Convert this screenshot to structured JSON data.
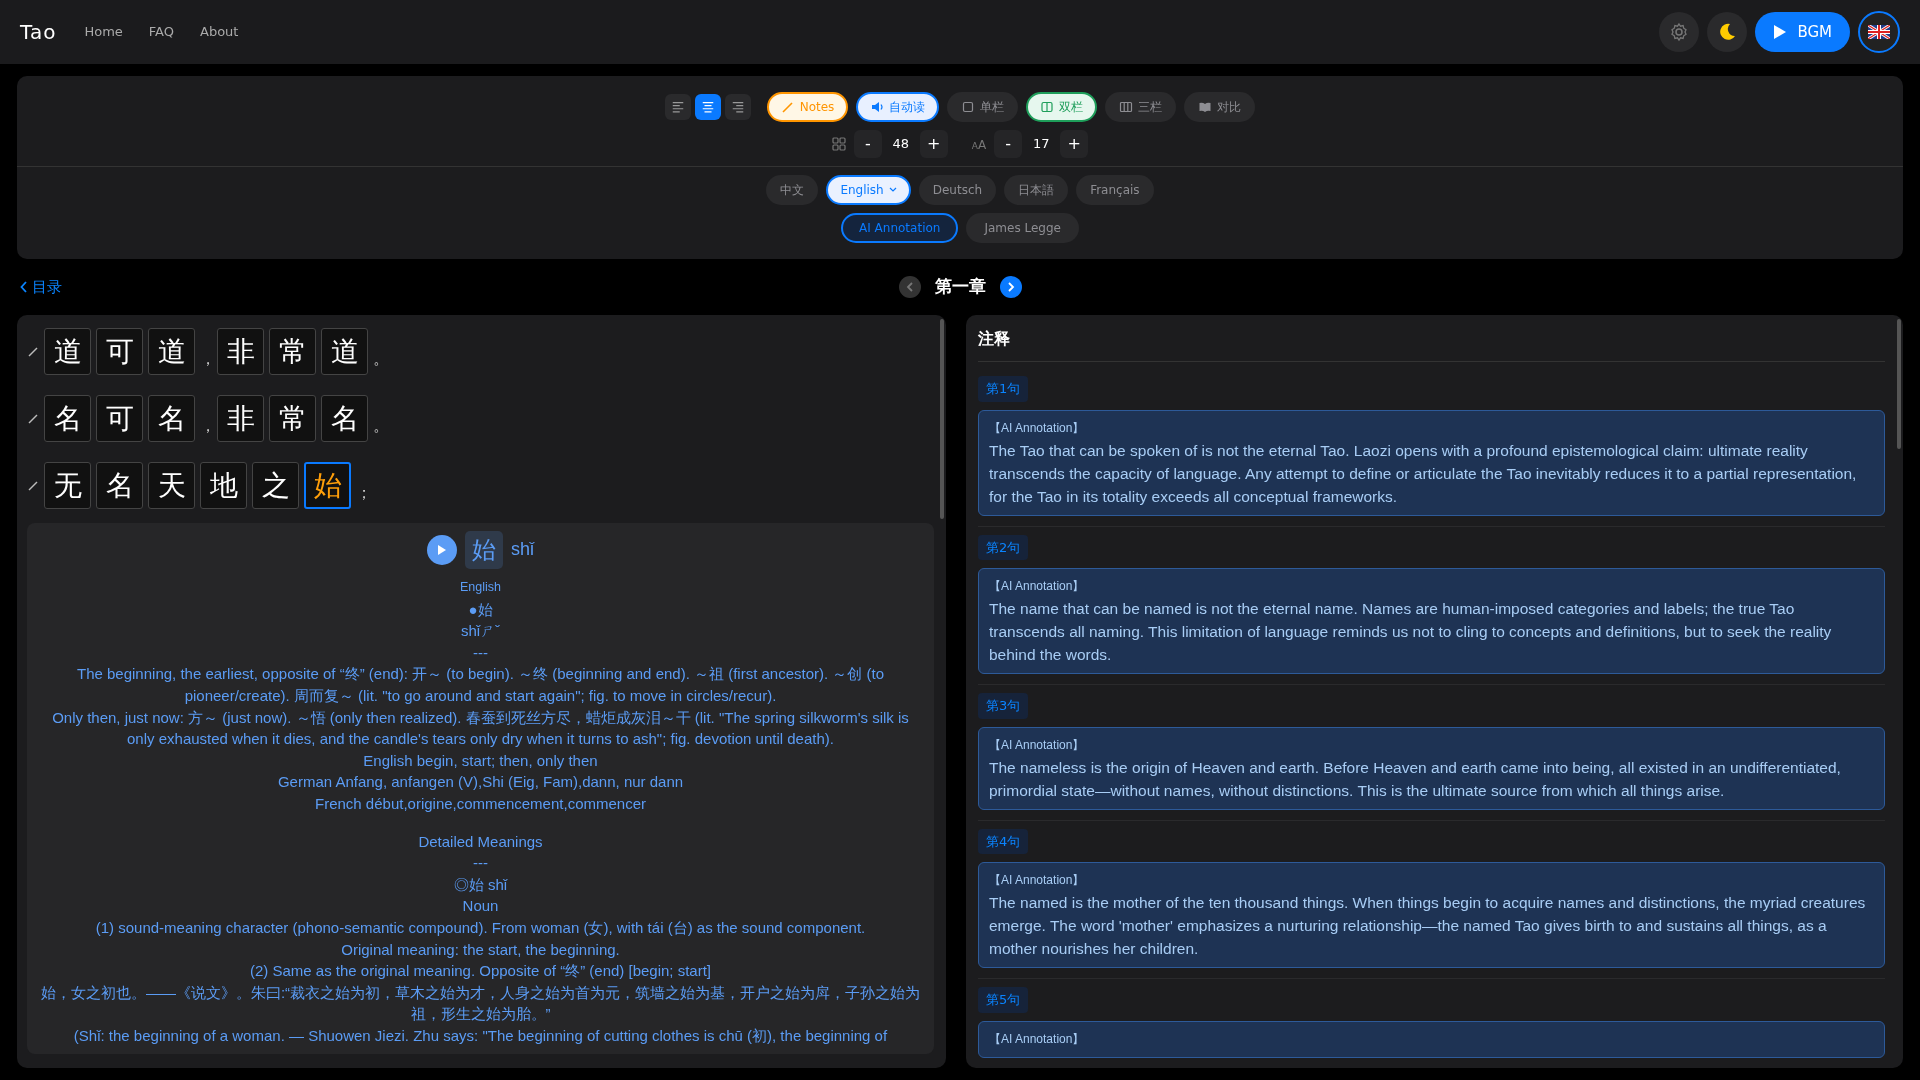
{
  "navbar": {
    "brand": "Tao",
    "links": [
      "Home",
      "FAQ",
      "About"
    ],
    "bgm_button": "BGM"
  },
  "toolbar": {
    "align": [
      {
        "kind": "left",
        "selected": false
      },
      {
        "kind": "center",
        "selected": true
      },
      {
        "kind": "right",
        "selected": false
      }
    ],
    "toggles": [
      {
        "kind": "notes",
        "label": "Notes",
        "on": true
      },
      {
        "kind": "audio",
        "label": "自动读",
        "on": true
      },
      {
        "kind": "single",
        "label": "单栏",
        "on": false
      },
      {
        "kind": "double",
        "label": "双栏",
        "on": true
      },
      {
        "kind": "triple",
        "label": "三栏",
        "on": false
      },
      {
        "kind": "compare",
        "label": "对比",
        "on": false
      }
    ],
    "grid_size": "48",
    "font_label": "AA",
    "font_size": "17",
    "decrease": "-",
    "increase": "+",
    "languages": [
      {
        "label": "中文",
        "selected": false
      },
      {
        "label": "English",
        "selected": true
      },
      {
        "label": "Deutsch",
        "selected": false
      },
      {
        "label": "日本語",
        "selected": false
      },
      {
        "label": "Français",
        "selected": false
      }
    ],
    "sources": [
      {
        "label": "AI Annotation",
        "selected": true
      },
      {
        "label": "James Legge",
        "selected": false
      }
    ]
  },
  "chapter_nav": {
    "back": "目录",
    "title": "第一章",
    "prev_enabled": false,
    "next_enabled": true
  },
  "verses": [
    {
      "tokens": [
        {
          "kind": "char",
          "text": "道",
          "selected": false
        },
        {
          "kind": "char",
          "text": "可",
          "selected": false
        },
        {
          "kind": "char",
          "text": "道",
          "selected": false
        },
        {
          "kind": "punct",
          "text": "，"
        },
        {
          "kind": "char",
          "text": "非",
          "selected": false
        },
        {
          "kind": "char",
          "text": "常",
          "selected": false
        },
        {
          "kind": "char",
          "text": "道",
          "selected": false
        },
        {
          "kind": "punct",
          "text": "。"
        }
      ]
    },
    {
      "tokens": [
        {
          "kind": "char",
          "text": "名",
          "selected": false
        },
        {
          "kind": "char",
          "text": "可",
          "selected": false
        },
        {
          "kind": "char",
          "text": "名",
          "selected": false
        },
        {
          "kind": "punct",
          "text": "，"
        },
        {
          "kind": "char",
          "text": "非",
          "selected": false
        },
        {
          "kind": "char",
          "text": "常",
          "selected": false
        },
        {
          "kind": "char",
          "text": "名",
          "selected": false
        },
        {
          "kind": "punct",
          "text": "。"
        }
      ]
    },
    {
      "tokens": [
        {
          "kind": "char",
          "text": "无",
          "selected": false
        },
        {
          "kind": "char",
          "text": "名",
          "selected": false
        },
        {
          "kind": "char",
          "text": "天",
          "selected": false
        },
        {
          "kind": "char",
          "text": "地",
          "selected": false
        },
        {
          "kind": "char",
          "text": "之",
          "selected": false
        },
        {
          "kind": "char",
          "text": "始",
          "selected": true
        },
        {
          "kind": "punct",
          "text": "；"
        }
      ]
    }
  ],
  "detail": {
    "char": "始",
    "pinyin": "shǐ",
    "lines": [
      {
        "kind": "label",
        "text": "English"
      },
      {
        "kind": "line",
        "text": "●始"
      },
      {
        "kind": "line",
        "text": "shǐㄕˇ"
      },
      {
        "kind": "line",
        "text": "---"
      },
      {
        "kind": "line",
        "text": "The beginning, the earliest, opposite of “终” (end): 开～ (to begin). ～终 (beginning and end). ～祖 (first ancestor). ～创 (to pioneer/create). 周而复～ (lit. \"to go around and start again\"; fig. to move in circles/recur)."
      },
      {
        "kind": "line",
        "text": "Only then, just now: 方～ (just now). ～悟 (only then realized). 春蚕到死丝方尽，蜡炬成灰泪～干 (lit. \"The spring silkworm's silk is only exhausted when it dies, and the candle's tears only dry when it turns to ash\"; fig. devotion until death)."
      },
      {
        "kind": "line",
        "text": "English begin, start; then, only then"
      },
      {
        "kind": "line",
        "text": "German Anfang, anfangen (V),Shi (Eig, Fam),dann, nur dann"
      },
      {
        "kind": "line",
        "text": "French début,origine,commencement,commencer"
      },
      {
        "kind": "heading",
        "text": "Detailed Meanings"
      },
      {
        "kind": "line",
        "text": "---"
      },
      {
        "kind": "line",
        "text": "◎始 shǐ"
      },
      {
        "kind": "line",
        "text": "Noun"
      },
      {
        "kind": "line",
        "text": "(1) sound-meaning character (phono-semantic compound). From woman (女), with tái (台) as the sound component."
      },
      {
        "kind": "line",
        "text": "Original meaning: the start, the beginning."
      },
      {
        "kind": "line",
        "text": "(2) Same as the original meaning. Opposite of “终” (end) [begin; start]"
      },
      {
        "kind": "line",
        "text": "始，女之初也。——《说文》。朱曰:“裁衣之始为初，草木之始为才，人身之始为首为元，筑墙之始为基，开户之始为戽，子孙之始为祖，形生之始为胎。”"
      },
      {
        "kind": "line",
        "text": "(Shǐ: the beginning of a woman. — Shuowen Jiezi. Zhu says: \"The beginning of cutting clothes is chū (初), the beginning of"
      }
    ]
  },
  "notes": {
    "title": "注释",
    "items": [
      {
        "label": "第1句",
        "source": "【AI Annotation】",
        "text": "The Tao that can be spoken of is not the eternal Tao. Laozi opens with a profound epistemological claim: ultimate reality transcends the capacity of language. Any attempt to define or articulate the Tao inevitably reduces it to a partial representation, for the Tao in its totality exceeds all conceptual frameworks."
      },
      {
        "label": "第2句",
        "source": "【AI Annotation】",
        "text": "The name that can be named is not the eternal name. Names are human-imposed categories and labels; the true Tao transcends all naming. This limitation of language reminds us not to cling to concepts and definitions, but to seek the reality behind the words."
      },
      {
        "label": "第3句",
        "source": "【AI Annotation】",
        "text": "The nameless is the origin of Heaven and earth. Before Heaven and earth came into being, all existed in an undifferentiated, primordial state—without names, without distinctions. This is the ultimate source from which all things arise."
      },
      {
        "label": "第4句",
        "source": "【AI Annotation】",
        "text": "The named is the mother of the ten thousand things. When things begin to acquire names and distinctions, the myriad creatures emerge. The word 'mother' emphasizes a nurturing relationship—the named Tao gives birth to and sustains all things, as a mother nourishes her children."
      },
      {
        "label": "第5句",
        "source": "【AI Annotation】"
      }
    ]
  }
}
